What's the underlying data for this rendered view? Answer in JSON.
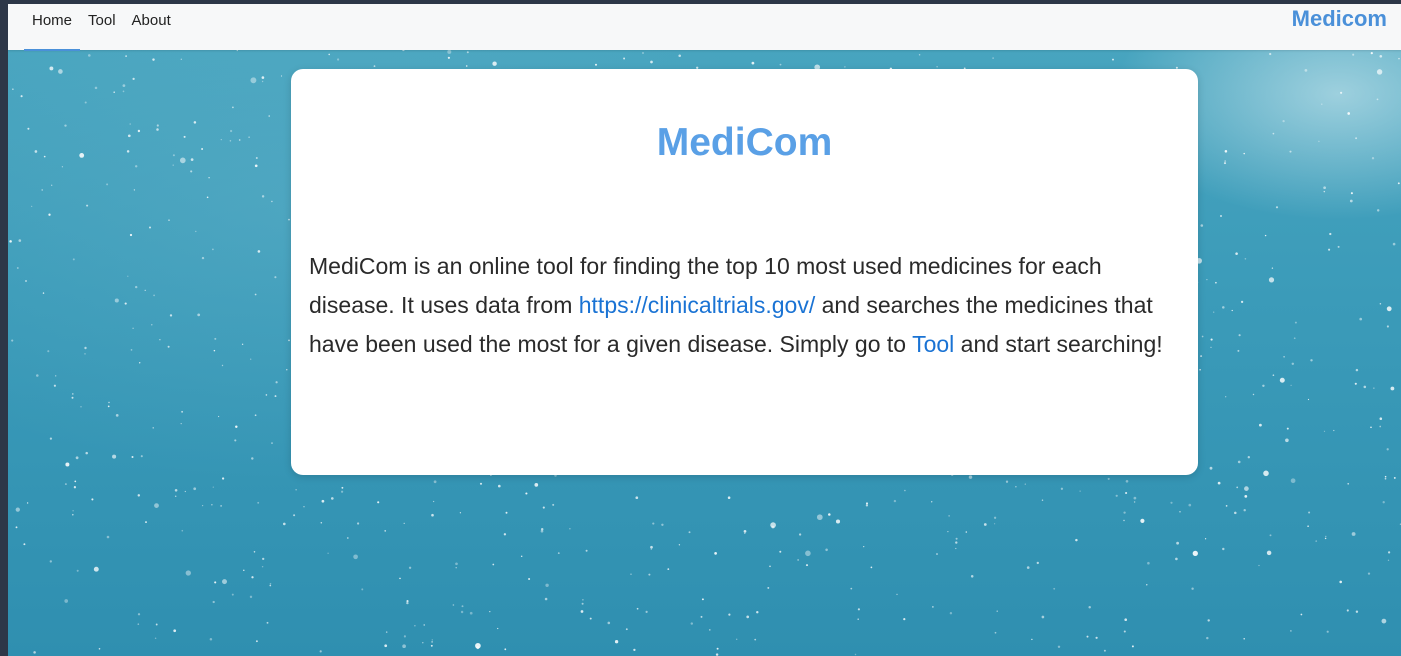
{
  "nav": {
    "tabs": [
      {
        "label": "Home",
        "active": true
      },
      {
        "label": "Tool",
        "active": false
      },
      {
        "label": "About",
        "active": false
      }
    ],
    "brand": "Medicom"
  },
  "card": {
    "title": "MediCom",
    "text_part1": "MediCom is an online tool for finding the top 10 most used medicines for each disease. It uses data from ",
    "link_clinicaltrials": "https://clinicaltrials.gov/",
    "text_part2": " and searches the medicines that have been used the most for a given disease. Simply go to ",
    "link_tool": "Tool",
    "text_part3": " and start searching!"
  },
  "colors": {
    "accent": "#4a90d9",
    "title": "#5aa0e6",
    "link": "#1a73d4",
    "background": "#3b9bb9"
  }
}
